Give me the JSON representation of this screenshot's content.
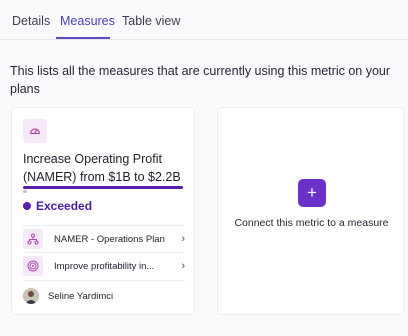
{
  "tabs": [
    {
      "label": "Details",
      "active": false
    },
    {
      "label": "Measures",
      "active": true
    },
    {
      "label": "Table view",
      "active": false
    }
  ],
  "description": "This lists all the measures that are currently using this metric on your plans",
  "measure_card": {
    "icon": "gauge-icon",
    "title": "Increase Operating Profit (NAMER) from $1B to $2.2B",
    "progress": 1.0,
    "status": {
      "label": "Exceeded",
      "color": "#5a1fa8"
    },
    "links": [
      {
        "icon": "hierarchy-icon",
        "label": "NAMER - Operations Plan"
      },
      {
        "icon": "target-icon",
        "label": "Improve profitability in..."
      }
    ],
    "owner": {
      "name": "Seline Yardimci"
    }
  },
  "connect_card": {
    "button_icon": "plus-icon",
    "label": "Connect this metric to a measure"
  },
  "colors": {
    "accent": "#5b4cc4",
    "status_purple": "#5a1fa8",
    "icon_bg": "#f6e9f7",
    "button": "#6a32c9"
  }
}
